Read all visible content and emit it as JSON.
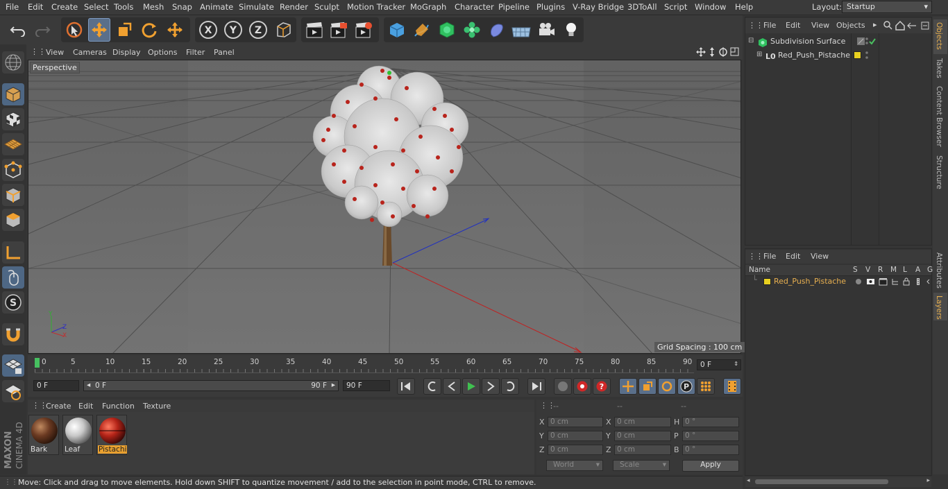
{
  "menubar": {
    "items": [
      "File",
      "Edit",
      "Create",
      "Select",
      "Tools",
      "Mesh",
      "Snap",
      "Animate",
      "Simulate",
      "Render",
      "Sculpt",
      "Motion Tracker",
      "MoGraph",
      "Character",
      "Pipeline",
      "Plugins",
      "V-Ray Bridge",
      "3DToAll",
      "Script",
      "Window",
      "Help"
    ],
    "layout_label": "Layout:",
    "layout_value": "Startup"
  },
  "viewport": {
    "menu": [
      "View",
      "Cameras",
      "Display",
      "Options",
      "Filter",
      "Panel"
    ],
    "camera_label": "Perspective",
    "grid_spacing": "Grid Spacing : 100 cm"
  },
  "timeline": {
    "ticks": [
      "0",
      "5",
      "10",
      "15",
      "20",
      "25",
      "30",
      "35",
      "40",
      "45",
      "50",
      "55",
      "60",
      "65",
      "70",
      "75",
      "80",
      "85",
      "90"
    ],
    "current_frame": "0 F"
  },
  "transport": {
    "start_field": "0 F",
    "range_start": "0 F",
    "range_end": "90 F",
    "end_field": "90 F"
  },
  "materials": {
    "menu": [
      "Create",
      "Edit",
      "Function",
      "Texture"
    ],
    "items": [
      {
        "name": "Bark",
        "color": "#6b3a22"
      },
      {
        "name": "Leaf",
        "color": "#d8d8d8"
      },
      {
        "name": "Pistachi",
        "color": "#b42418"
      }
    ]
  },
  "coords": {
    "header": [
      "--",
      "--",
      "--"
    ],
    "rows": [
      {
        "l1": "X",
        "v1": "0 cm",
        "l2": "X",
        "v2": "0 cm",
        "l3": "H",
        "v3": "0 °"
      },
      {
        "l1": "Y",
        "v1": "0 cm",
        "l2": "Y",
        "v2": "0 cm",
        "l3": "P",
        "v3": "0 °"
      },
      {
        "l1": "Z",
        "v1": "0 cm",
        "l2": "Z",
        "v2": "0 cm",
        "l3": "B",
        "v3": "0 °"
      }
    ],
    "world_select": "World",
    "scale_select": "Scale",
    "apply_label": "Apply"
  },
  "status": {
    "text": "Move: Click and drag to move elements. Hold down SHIFT to quantize movement / add to the selection in point mode, CTRL to remove."
  },
  "objects": {
    "menu": [
      "File",
      "Edit",
      "View",
      "Objects"
    ],
    "tree": [
      {
        "name": "Subdivision Surface"
      },
      {
        "name": "Red_Push_Pistache"
      }
    ]
  },
  "layers": {
    "menu": [
      "File",
      "Edit",
      "View"
    ],
    "columns": [
      "Name",
      "S",
      "V",
      "R",
      "M",
      "L",
      "A",
      "G"
    ],
    "items": [
      {
        "name": "Red_Push_Pistache",
        "color": "#e8d020"
      }
    ]
  },
  "sidetabs": [
    "Objects",
    "Takes",
    "Content Browser",
    "Structure",
    "Attributes",
    "Layers"
  ],
  "branding": {
    "logo_text": "MAXON CINEMA 4D"
  },
  "colors": {
    "accent": "#e8b050",
    "selection": "#5a6f8a"
  }
}
